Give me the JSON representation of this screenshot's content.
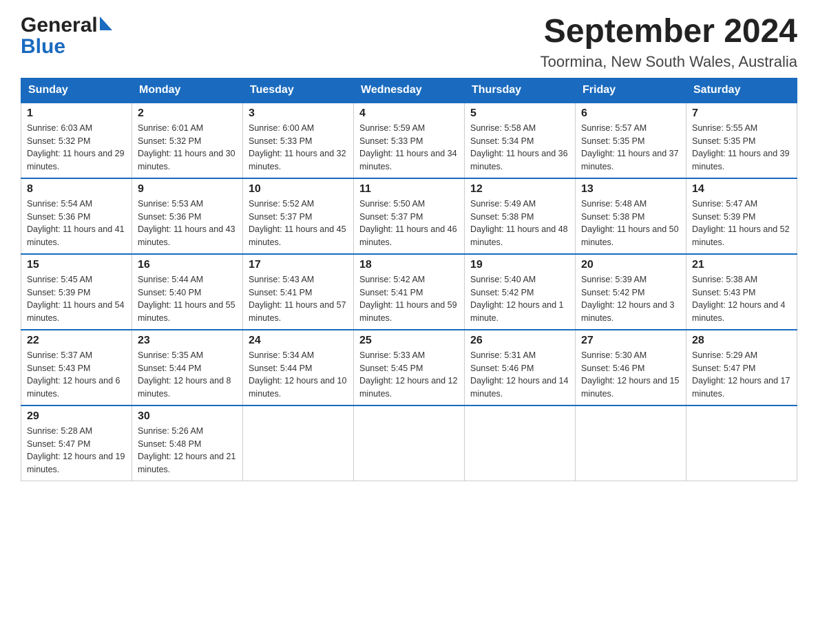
{
  "header": {
    "logo_general": "General",
    "logo_blue": "Blue",
    "month_title": "September 2024",
    "location": "Toormina, New South Wales, Australia"
  },
  "weekdays": [
    "Sunday",
    "Monday",
    "Tuesday",
    "Wednesday",
    "Thursday",
    "Friday",
    "Saturday"
  ],
  "weeks": [
    [
      {
        "day": "1",
        "sunrise": "6:03 AM",
        "sunset": "5:32 PM",
        "daylight": "11 hours and 29 minutes."
      },
      {
        "day": "2",
        "sunrise": "6:01 AM",
        "sunset": "5:32 PM",
        "daylight": "11 hours and 30 minutes."
      },
      {
        "day": "3",
        "sunrise": "6:00 AM",
        "sunset": "5:33 PM",
        "daylight": "11 hours and 32 minutes."
      },
      {
        "day": "4",
        "sunrise": "5:59 AM",
        "sunset": "5:33 PM",
        "daylight": "11 hours and 34 minutes."
      },
      {
        "day": "5",
        "sunrise": "5:58 AM",
        "sunset": "5:34 PM",
        "daylight": "11 hours and 36 minutes."
      },
      {
        "day": "6",
        "sunrise": "5:57 AM",
        "sunset": "5:35 PM",
        "daylight": "11 hours and 37 minutes."
      },
      {
        "day": "7",
        "sunrise": "5:55 AM",
        "sunset": "5:35 PM",
        "daylight": "11 hours and 39 minutes."
      }
    ],
    [
      {
        "day": "8",
        "sunrise": "5:54 AM",
        "sunset": "5:36 PM",
        "daylight": "11 hours and 41 minutes."
      },
      {
        "day": "9",
        "sunrise": "5:53 AM",
        "sunset": "5:36 PM",
        "daylight": "11 hours and 43 minutes."
      },
      {
        "day": "10",
        "sunrise": "5:52 AM",
        "sunset": "5:37 PM",
        "daylight": "11 hours and 45 minutes."
      },
      {
        "day": "11",
        "sunrise": "5:50 AM",
        "sunset": "5:37 PM",
        "daylight": "11 hours and 46 minutes."
      },
      {
        "day": "12",
        "sunrise": "5:49 AM",
        "sunset": "5:38 PM",
        "daylight": "11 hours and 48 minutes."
      },
      {
        "day": "13",
        "sunrise": "5:48 AM",
        "sunset": "5:38 PM",
        "daylight": "11 hours and 50 minutes."
      },
      {
        "day": "14",
        "sunrise": "5:47 AM",
        "sunset": "5:39 PM",
        "daylight": "11 hours and 52 minutes."
      }
    ],
    [
      {
        "day": "15",
        "sunrise": "5:45 AM",
        "sunset": "5:39 PM",
        "daylight": "11 hours and 54 minutes."
      },
      {
        "day": "16",
        "sunrise": "5:44 AM",
        "sunset": "5:40 PM",
        "daylight": "11 hours and 55 minutes."
      },
      {
        "day": "17",
        "sunrise": "5:43 AM",
        "sunset": "5:41 PM",
        "daylight": "11 hours and 57 minutes."
      },
      {
        "day": "18",
        "sunrise": "5:42 AM",
        "sunset": "5:41 PM",
        "daylight": "11 hours and 59 minutes."
      },
      {
        "day": "19",
        "sunrise": "5:40 AM",
        "sunset": "5:42 PM",
        "daylight": "12 hours and 1 minute."
      },
      {
        "day": "20",
        "sunrise": "5:39 AM",
        "sunset": "5:42 PM",
        "daylight": "12 hours and 3 minutes."
      },
      {
        "day": "21",
        "sunrise": "5:38 AM",
        "sunset": "5:43 PM",
        "daylight": "12 hours and 4 minutes."
      }
    ],
    [
      {
        "day": "22",
        "sunrise": "5:37 AM",
        "sunset": "5:43 PM",
        "daylight": "12 hours and 6 minutes."
      },
      {
        "day": "23",
        "sunrise": "5:35 AM",
        "sunset": "5:44 PM",
        "daylight": "12 hours and 8 minutes."
      },
      {
        "day": "24",
        "sunrise": "5:34 AM",
        "sunset": "5:44 PM",
        "daylight": "12 hours and 10 minutes."
      },
      {
        "day": "25",
        "sunrise": "5:33 AM",
        "sunset": "5:45 PM",
        "daylight": "12 hours and 12 minutes."
      },
      {
        "day": "26",
        "sunrise": "5:31 AM",
        "sunset": "5:46 PM",
        "daylight": "12 hours and 14 minutes."
      },
      {
        "day": "27",
        "sunrise": "5:30 AM",
        "sunset": "5:46 PM",
        "daylight": "12 hours and 15 minutes."
      },
      {
        "day": "28",
        "sunrise": "5:29 AM",
        "sunset": "5:47 PM",
        "daylight": "12 hours and 17 minutes."
      }
    ],
    [
      {
        "day": "29",
        "sunrise": "5:28 AM",
        "sunset": "5:47 PM",
        "daylight": "12 hours and 19 minutes."
      },
      {
        "day": "30",
        "sunrise": "5:26 AM",
        "sunset": "5:48 PM",
        "daylight": "12 hours and 21 minutes."
      },
      null,
      null,
      null,
      null,
      null
    ]
  ],
  "labels": {
    "sunrise": "Sunrise:",
    "sunset": "Sunset:",
    "daylight": "Daylight:"
  }
}
